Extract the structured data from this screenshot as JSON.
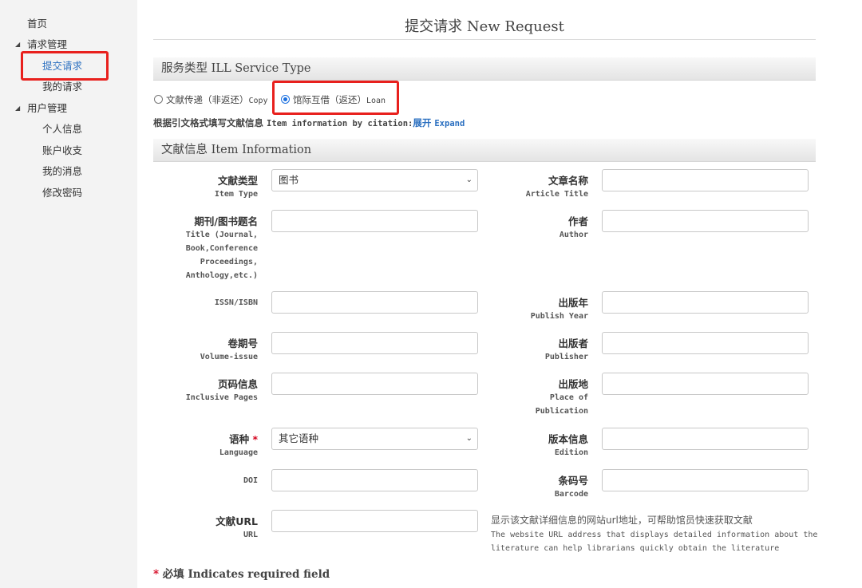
{
  "sidebar": {
    "home": "首页",
    "request_mgmt": "请求管理",
    "submit_request": "提交请求",
    "my_requests": "我的请求",
    "user_mgmt": "用户管理",
    "personal_info": "个人信息",
    "account": "账户收支",
    "messages": "我的消息",
    "change_password": "修改密码"
  },
  "page": {
    "title": "提交请求 New Request"
  },
  "service": {
    "header": "服务类型 ILL Service Type",
    "copy_zh": "文献传递（非返还）",
    "copy_en": "Copy",
    "loan_zh": "馆际互借（返还）",
    "loan_en": "Loan",
    "selected": "loan"
  },
  "citation": {
    "zh": "根据引文格式填写文献信息",
    "en": "Item information by citation:",
    "expand_zh": "展开",
    "expand_en": "Expand"
  },
  "item": {
    "header": "文献信息 Item Information",
    "item_type": {
      "zh": "文献类型",
      "en": "Item Type",
      "value": "图书"
    },
    "article_title": {
      "zh": "文章名称",
      "en": "Article Title",
      "value": ""
    },
    "journal_title": {
      "zh": "期刊/图书题名",
      "en1": "Title (Journal,",
      "en2": "Book,Conference",
      "en3": "Proceedings,",
      "en4": "Anthology,etc.)",
      "value": ""
    },
    "author": {
      "zh": "作者",
      "en": "Author",
      "value": ""
    },
    "issn": {
      "en": "ISSN/ISBN",
      "value": ""
    },
    "publish_year": {
      "zh": "出版年",
      "en": "Publish Year",
      "value": ""
    },
    "volume": {
      "zh": "卷期号",
      "en": "Volume-issue",
      "value": ""
    },
    "publisher": {
      "zh": "出版者",
      "en": "Publisher",
      "value": ""
    },
    "pages": {
      "zh": "页码信息",
      "en": "Inclusive Pages",
      "value": ""
    },
    "place": {
      "zh": "出版地",
      "en1": "Place of",
      "en2": "Publication",
      "value": ""
    },
    "language": {
      "zh": "语种",
      "star": "*",
      "en": "Language",
      "value": "其它语种"
    },
    "edition": {
      "zh": "版本信息",
      "en": "Edition",
      "value": ""
    },
    "doi": {
      "en": "DOI",
      "value": ""
    },
    "barcode": {
      "zh": "条码号",
      "en": "Barcode",
      "value": ""
    },
    "url": {
      "zh": "文献URL",
      "en": "URL",
      "value": ""
    },
    "url_hint_zh": "显示该文献详细信息的网站url地址，可帮助馆员快速获取文献",
    "url_hint_en1": "The website URL address that displays detailed information about the",
    "url_hint_en2": "literature can help librarians quickly obtain the literature"
  },
  "footer": {
    "star": "*",
    "zh": "必填",
    "en": "Indicates required field"
  },
  "colors": {
    "accent": "#2a6fc0",
    "highlight": "#e8201d",
    "required": "#d4001c"
  }
}
